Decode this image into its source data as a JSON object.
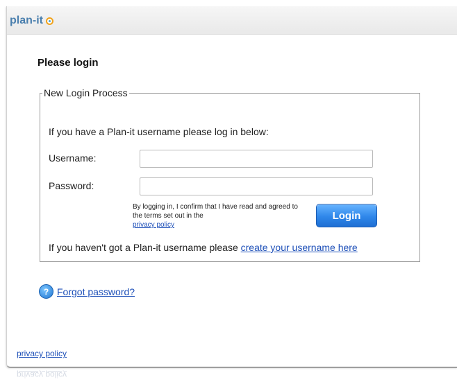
{
  "brand": {
    "name": "plan-it",
    "accent": "#f0a21b",
    "text_color": "#4a7fae"
  },
  "page": {
    "heading": "Please login"
  },
  "login_form": {
    "legend": "New Login Process",
    "intro": "If you have a Plan-it username please log in below:",
    "username_label": "Username:",
    "username_value": "",
    "password_label": "Password:",
    "password_value": "",
    "confirm_text": "By logging in, I confirm that I have read and agreed to the terms set out in the",
    "confirm_link": "privacy policy",
    "login_button": "Login",
    "no_account_text": "If you haven't got a Plan-it username please",
    "create_link": "create your username here"
  },
  "forgot": {
    "icon": "help-icon",
    "label": "Forgot password?"
  },
  "footer": {
    "privacy_link": "privacy policy"
  },
  "colors": {
    "link": "#1d4fb8",
    "button": "#2f87ea"
  }
}
